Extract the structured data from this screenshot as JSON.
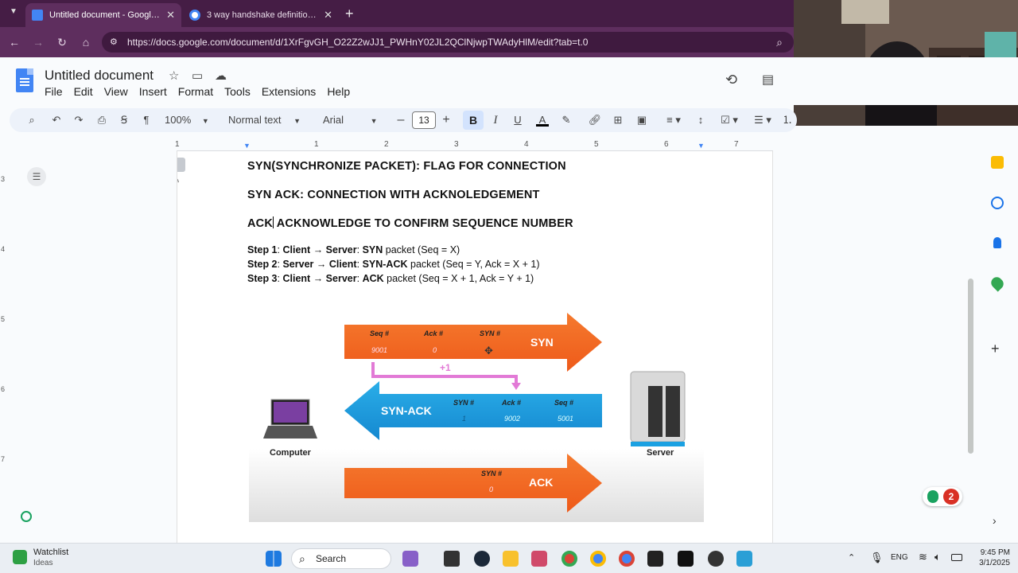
{
  "browser": {
    "tabs": [
      {
        "title": "Untitled document - Google Docs",
        "active": true,
        "favicon_color": "#4285f4"
      },
      {
        "title": "3 way handshake definition - Google Search",
        "active": false,
        "favicon_color": "#ffffff"
      }
    ],
    "new_tab_symbol": "+",
    "url": "https://docs.google.com/document/d/1XrFgvGH_O22Z2wJJ1_PWHnY02JL2QClNjwpTWAdyHlM/edit?tab=t.0",
    "accent_color": "#5e2e5e"
  },
  "doc": {
    "title": "Untitled document",
    "menu": [
      "File",
      "Edit",
      "View",
      "Insert",
      "Format",
      "Tools",
      "Extensions",
      "Help"
    ],
    "toolbar": {
      "zoom": "100%",
      "style": "Normal text",
      "font": "Arial",
      "font_size": "13",
      "bold_label": "B",
      "italic_label": "I",
      "underline_label": "U",
      "text_color_label": "A"
    },
    "ruler": [
      "1",
      "1",
      "2",
      "3",
      "4",
      "5",
      "6",
      "7"
    ],
    "vruler": [
      "3",
      "4",
      "5",
      "6",
      "7"
    ],
    "headings": [
      "SYN(SYNCHRONIZE PACKET): FLAG FOR CONNECTION",
      "SYN ACK: CONNECTION WITH ACKNOLEDGEMENT"
    ],
    "ack_heading": {
      "before": "ACK",
      "after": " ACKNOWLEDGE TO CONFIRM SEQUENCE NUMBER"
    },
    "steps": [
      {
        "step": "Step 1",
        "from": "Client",
        "arrow": "→",
        "to": "Server",
        "kind": "SYN",
        "rest": " packet (Seq = X)"
      },
      {
        "step": "Step 2",
        "from": "Server",
        "arrow": "→",
        "to": "Client",
        "kind": "SYN-ACK",
        "rest": " packet (Seq = Y, Ack = X + 1)"
      },
      {
        "step": "Step 3",
        "from": "Client",
        "arrow": "→",
        "to": "Server",
        "kind": "ACK",
        "rest": " packet (Seq = X + 1, Ack = Y + 1)"
      }
    ]
  },
  "diagram": {
    "syn": {
      "label": "SYN",
      "fields": [
        "Seq #",
        "Ack #",
        "SYN #"
      ],
      "values": [
        "9001",
        "0"
      ]
    },
    "plus_one": "+1",
    "synack": {
      "label": "SYN-ACK",
      "fields": [
        "SYN #",
        "Ack #",
        "Seq #"
      ],
      "values": [
        "1",
        "9002",
        "5001"
      ]
    },
    "ack": {
      "label": "ACK",
      "fields": [
        "SYN #"
      ],
      "values": [
        "0"
      ]
    },
    "computer_label": "Computer",
    "server_label": "Server",
    "colors": {
      "orange": "#f26522",
      "blue": "#1ba1e2",
      "pink": "#e27ad6"
    }
  },
  "notification_count": "2",
  "taskbar": {
    "widget_title": "Watchlist",
    "widget_subtitle": "Ideas",
    "search_label": "Search",
    "language": "ENG",
    "time": "9:45 PM",
    "date": "3/1/2025"
  }
}
